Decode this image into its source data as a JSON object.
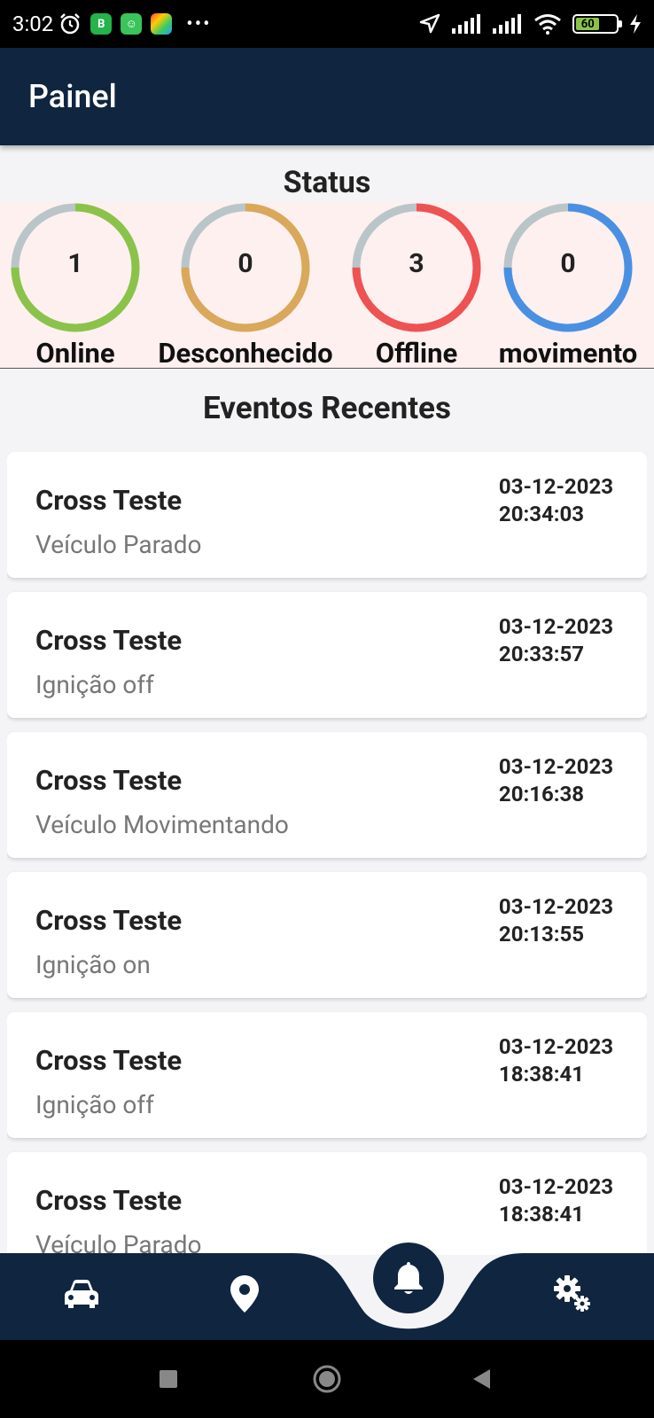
{
  "status_bar": {
    "time": "3:02",
    "battery_level": "60",
    "more_dots": "•••"
  },
  "appbar": {
    "title": "Painel"
  },
  "status_section": {
    "title": "Status",
    "gauges": [
      {
        "value": "1",
        "label": "Online",
        "color": "#8BC34A",
        "fraction": 0.75
      },
      {
        "value": "0",
        "label": "Desconhecido",
        "color": "#D9A85A",
        "fraction": 0.75
      },
      {
        "value": "3",
        "label": "Offline",
        "color": "#EE5253",
        "fraction": 0.75
      },
      {
        "value": "0",
        "label": "movimento",
        "color": "#4A90E2",
        "fraction": 0.75
      }
    ],
    "track_color": "#B9C5C9"
  },
  "events": {
    "title": "Eventos Recentes",
    "items": [
      {
        "name": "Cross Teste",
        "event": "Veículo Parado",
        "date": "03-12-2023",
        "time": "20:34:03"
      },
      {
        "name": "Cross Teste",
        "event": "Ignição off",
        "date": "03-12-2023",
        "time": "20:33:57"
      },
      {
        "name": "Cross Teste",
        "event": "Veículo Movimentando",
        "date": "03-12-2023",
        "time": "20:16:38"
      },
      {
        "name": "Cross Teste",
        "event": "Ignição on",
        "date": "03-12-2023",
        "time": "20:13:55"
      },
      {
        "name": "Cross Teste",
        "event": "Ignição off",
        "date": "03-12-2023",
        "time": "18:38:41"
      },
      {
        "name": "Cross Teste",
        "event": "Veículo Parado",
        "date": "03-12-2023",
        "time": "18:38:41"
      }
    ]
  },
  "bottom_nav": {
    "items": [
      {
        "icon": "car-icon"
      },
      {
        "icon": "map-pin-icon"
      },
      {
        "icon": "bell-icon",
        "active": true
      },
      {
        "icon": "settings-gears-icon"
      }
    ],
    "color": "#0f2540"
  }
}
